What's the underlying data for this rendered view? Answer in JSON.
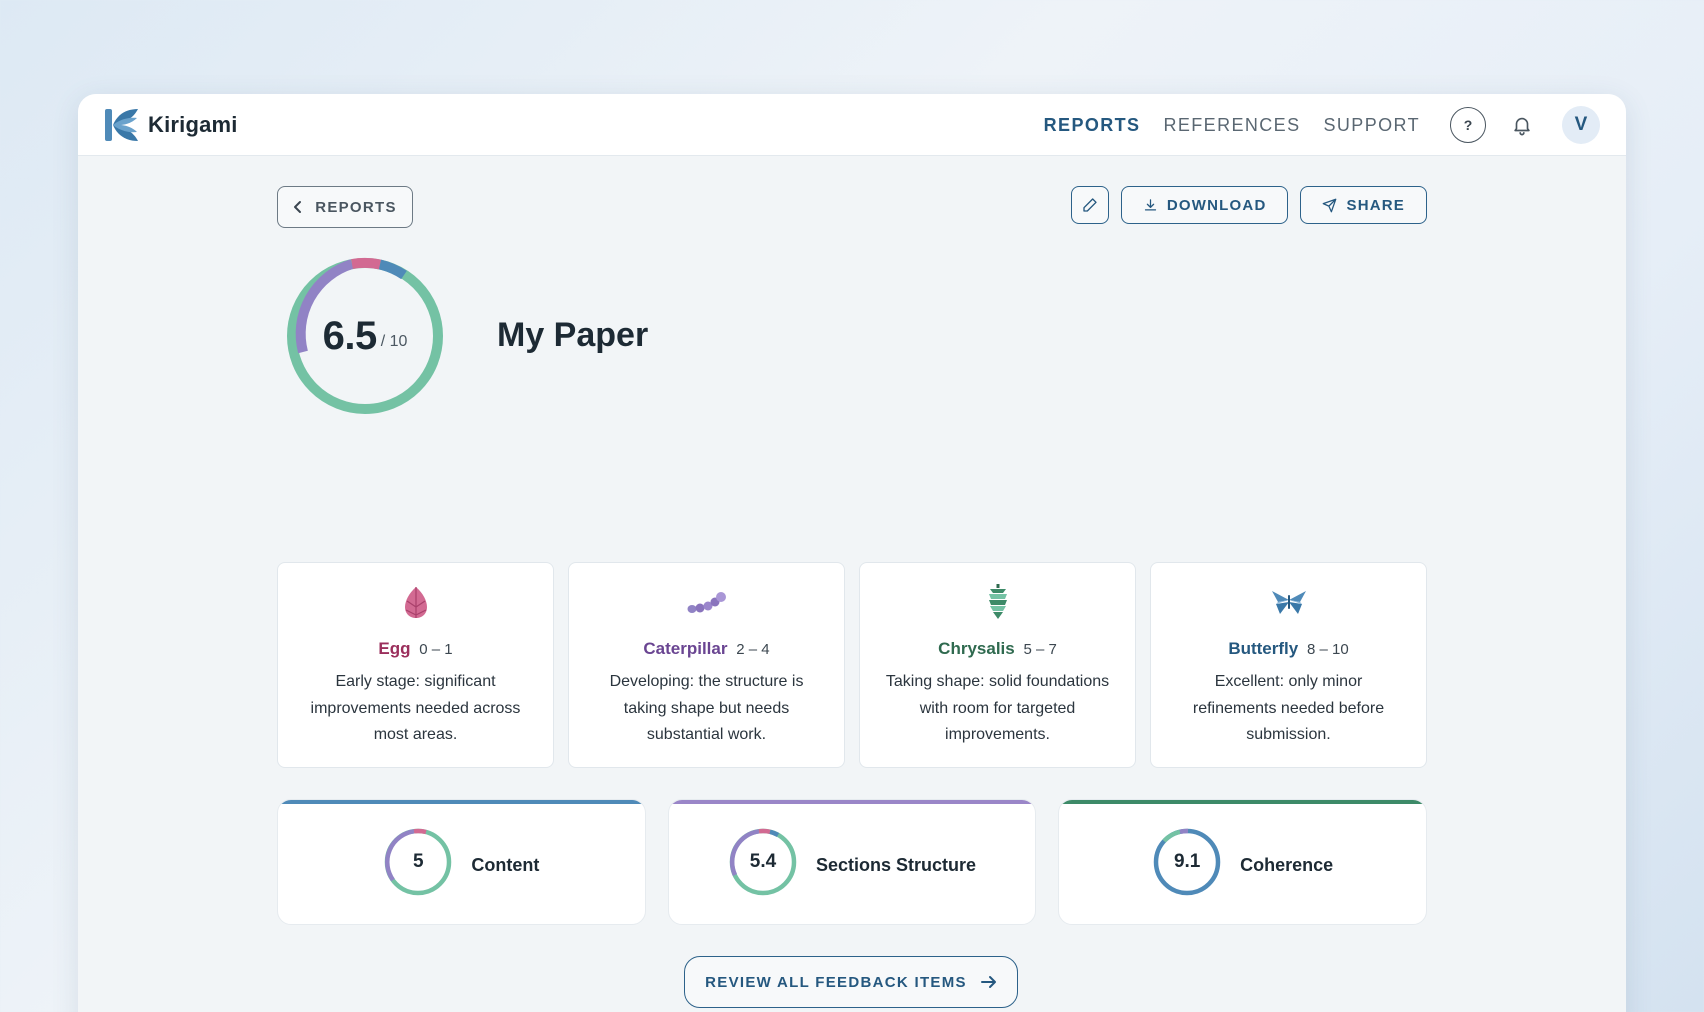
{
  "app": {
    "name": "Kirigami"
  },
  "nav": {
    "reports": "REPORTS",
    "references": "REFERENCES",
    "support": "SUPPORT"
  },
  "header": {
    "help": "?",
    "avatar_initial": "V"
  },
  "toolbar": {
    "back_label": "REPORTS",
    "download_label": "DOWNLOAD",
    "share_label": "SHARE"
  },
  "report": {
    "score": "6.5",
    "score_max": "/ 10",
    "title": "My Paper"
  },
  "stages": [
    {
      "name": "Egg",
      "range": "0 – 1",
      "description": "Early stage: significant improvements needed across most areas.",
      "color": "#9b2f5c",
      "icon": "egg-icon"
    },
    {
      "name": "Caterpillar",
      "range": "2 – 4",
      "description": "Developing: the structure is taking shape but needs substantial work.",
      "color": "#6a4592",
      "icon": "caterpillar-icon"
    },
    {
      "name": "Chrysalis",
      "range": "5 – 7",
      "description": "Taking shape: solid foundations with room for targeted improvements.",
      "color": "#2f6a4f",
      "icon": "chrysalis-icon"
    },
    {
      "name": "Butterfly",
      "range": "8 – 10",
      "description": "Excellent: only minor refinements needed before submission.",
      "color": "#25587f",
      "icon": "butterfly-icon"
    }
  ],
  "categories": [
    {
      "label": "Content",
      "score": "5",
      "accent": "#4f8ab8"
    },
    {
      "label": "Sections Structure",
      "score": "5.4",
      "accent": "#9a86c8"
    },
    {
      "label": "Coherence",
      "score": "9.1",
      "accent": "#3d8a68"
    }
  ],
  "review_button": {
    "label": "REVIEW ALL FEEDBACK ITEMS"
  },
  "colors": {
    "primary": "#25587f",
    "teal": "#74c2a4",
    "purple": "#9183c5",
    "pink": "#d26a92",
    "blue": "#4f8ab8"
  }
}
